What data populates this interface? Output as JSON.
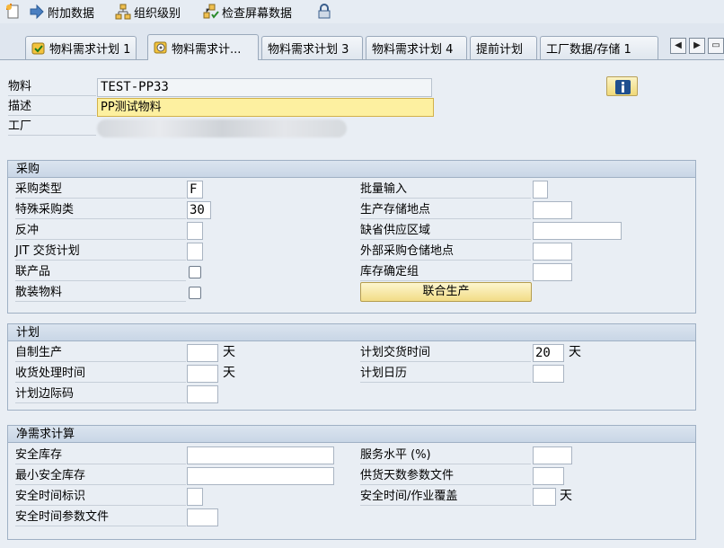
{
  "toolbar": {
    "items": [
      {
        "label": "",
        "icon": "new-doc-icon"
      },
      {
        "label": "附加数据",
        "icon": "arrow-right-icon"
      },
      {
        "label": "组织级别",
        "icon": "org-hierarchy-icon"
      },
      {
        "label": "检查屏幕数据",
        "icon": "check-structure-icon"
      },
      {
        "label": "",
        "icon": "lock-icon"
      }
    ]
  },
  "tabs": [
    {
      "label": "物料需求计划 1",
      "icon": "check-icon",
      "active": false
    },
    {
      "label": "物料需求计...",
      "icon": "disk-icon",
      "active": true
    },
    {
      "label": "物料需求计划 3",
      "active": false
    },
    {
      "label": "物料需求计划 4",
      "active": false
    },
    {
      "label": "提前计划",
      "active": false
    },
    {
      "label": "工厂数据/存储 1",
      "active": false
    }
  ],
  "header": {
    "material_label": "物料",
    "material_value": "TEST-PP33",
    "desc_label": "描述",
    "desc_value": "PP测试物料",
    "plant_label": "工厂"
  },
  "procurement": {
    "title": "采购",
    "left": [
      {
        "label": "采购类型",
        "value": "F",
        "kind": "input"
      },
      {
        "label": "特殊采购类",
        "value": "30",
        "kind": "input"
      },
      {
        "label": "反冲",
        "value": "",
        "kind": "input"
      },
      {
        "label": "JIT 交货计划",
        "value": "",
        "kind": "input"
      },
      {
        "label": "联产品",
        "value": "",
        "kind": "checkbox"
      },
      {
        "label": "散装物料",
        "value": "",
        "kind": "checkbox"
      }
    ],
    "right": [
      {
        "label": "批量输入",
        "value": ""
      },
      {
        "label": "生产存储地点",
        "value": ""
      },
      {
        "label": "缺省供应区域",
        "value": ""
      },
      {
        "label": "外部采购仓储地点",
        "value": ""
      },
      {
        "label": "库存确定组",
        "value": ""
      }
    ],
    "joint_production_button": "联合生产"
  },
  "planning": {
    "title": "计划",
    "left": [
      {
        "label": "自制生产",
        "value": "",
        "unit": "天"
      },
      {
        "label": "收货处理时间",
        "value": "",
        "unit": "天"
      },
      {
        "label": "计划边际码",
        "value": "",
        "unit": ""
      }
    ],
    "right": [
      {
        "label": "计划交货时间",
        "value": "20",
        "unit": "天"
      },
      {
        "label": "计划日历",
        "value": "",
        "unit": ""
      }
    ]
  },
  "net_req": {
    "title": "净需求计算",
    "left": [
      {
        "label": "安全库存",
        "value": ""
      },
      {
        "label": "最小安全库存",
        "value": ""
      },
      {
        "label": "安全时间标识",
        "value": ""
      },
      {
        "label": "安全时间参数文件",
        "value": ""
      }
    ],
    "right": [
      {
        "label": "服务水平 (%)",
        "value": "",
        "unit": ""
      },
      {
        "label": "供货天数参数文件",
        "value": "",
        "unit": ""
      },
      {
        "label": "安全时间/作业覆盖",
        "value": "",
        "unit": "天"
      }
    ]
  }
}
